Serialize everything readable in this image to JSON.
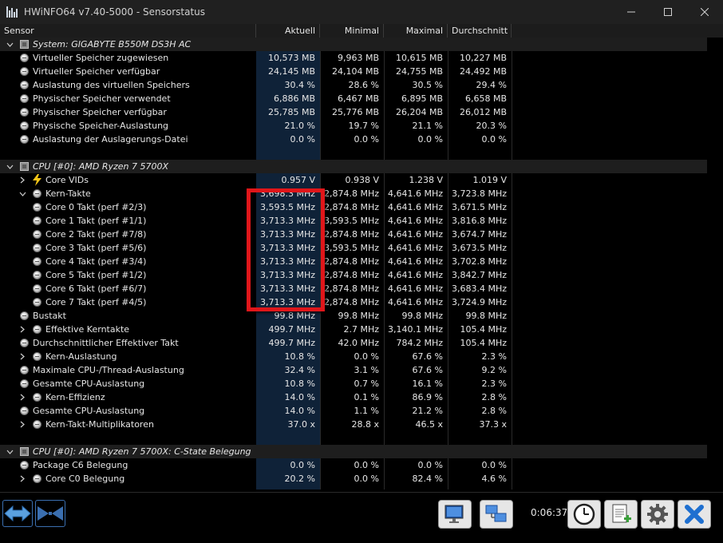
{
  "window": {
    "title": "HWiNFO64 v7.40-5000 - Sensorstatus"
  },
  "columns": {
    "sensor": "Sensor",
    "current": "Aktuell",
    "min": "Minimal",
    "max": "Maximal",
    "avg": "Durchschnitt"
  },
  "rows": [
    {
      "type": "group",
      "label": "System: GIGABYTE B550M DS3H AC"
    },
    {
      "type": "item",
      "label": "Virtueller Speicher zugewiesen",
      "cur": "10,573 MB",
      "min": "9,963 MB",
      "max": "10,615 MB",
      "avg": "10,227 MB"
    },
    {
      "type": "item",
      "label": "Virtueller Speicher verfügbar",
      "cur": "24,145 MB",
      "min": "24,104 MB",
      "max": "24,755 MB",
      "avg": "24,492 MB"
    },
    {
      "type": "item",
      "label": "Auslastung des virtuellen Speichers",
      "cur": "30.4 %",
      "min": "28.6 %",
      "max": "30.5 %",
      "avg": "29.4 %"
    },
    {
      "type": "item",
      "label": "Physischer Speicher verwendet",
      "cur": "6,886 MB",
      "min": "6,467 MB",
      "max": "6,895 MB",
      "avg": "6,658 MB"
    },
    {
      "type": "item",
      "label": "Physischer Speicher verfügbar",
      "cur": "25,785 MB",
      "min": "25,776 MB",
      "max": "26,204 MB",
      "avg": "26,012 MB"
    },
    {
      "type": "item",
      "label": "Physische Speicher-Auslastung",
      "cur": "21.0 %",
      "min": "19.7 %",
      "max": "21.1 %",
      "avg": "20.3 %"
    },
    {
      "type": "item",
      "label": "Auslastung der Auslagerungs-Datei",
      "cur": "0.0 %",
      "min": "0.0 %",
      "max": "0.0 %",
      "avg": "0.0 %"
    },
    {
      "type": "blank"
    },
    {
      "type": "group",
      "label": "CPU [#0]: AMD Ryzen 7 5700X"
    },
    {
      "type": "item",
      "icon": "bolt",
      "label": "Core VIDs",
      "cur": "0.957 V",
      "min": "0.938 V",
      "max": "1.238 V",
      "avg": "1.019 V",
      "expand": true,
      "indent": 1
    },
    {
      "type": "item",
      "label": "Kern-Takte",
      "cur": "3,698.3 MHz",
      "min": "2,874.8 MHz",
      "max": "4,641.6 MHz",
      "avg": "3,723.8 MHz",
      "expand": true,
      "expanded": true,
      "indent": 1
    },
    {
      "type": "item",
      "label": "Core 0 Takt (perf #2/3)",
      "cur": "3,593.5 MHz",
      "min": "2,874.8 MHz",
      "max": "4,641.6 MHz",
      "avg": "3,671.5 MHz",
      "indent": 2
    },
    {
      "type": "item",
      "label": "Core 1 Takt (perf #1/1)",
      "cur": "3,713.3 MHz",
      "min": "3,593.5 MHz",
      "max": "4,641.6 MHz",
      "avg": "3,816.8 MHz",
      "indent": 2
    },
    {
      "type": "item",
      "label": "Core 2 Takt (perf #7/8)",
      "cur": "3,713.3 MHz",
      "min": "2,874.8 MHz",
      "max": "4,641.6 MHz",
      "avg": "3,674.7 MHz",
      "indent": 2
    },
    {
      "type": "item",
      "label": "Core 3 Takt (perf #5/6)",
      "cur": "3,713.3 MHz",
      "min": "3,593.5 MHz",
      "max": "4,641.6 MHz",
      "avg": "3,673.5 MHz",
      "indent": 2
    },
    {
      "type": "item",
      "label": "Core 4 Takt (perf #3/4)",
      "cur": "3,713.3 MHz",
      "min": "2,874.8 MHz",
      "max": "4,641.6 MHz",
      "avg": "3,702.8 MHz",
      "indent": 2
    },
    {
      "type": "item",
      "label": "Core 5 Takt (perf #1/2)",
      "cur": "3,713.3 MHz",
      "min": "2,874.8 MHz",
      "max": "4,641.6 MHz",
      "avg": "3,842.7 MHz",
      "indent": 2
    },
    {
      "type": "item",
      "label": "Core 6 Takt (perf #6/7)",
      "cur": "3,713.3 MHz",
      "min": "2,874.8 MHz",
      "max": "4,641.6 MHz",
      "avg": "3,683.4 MHz",
      "indent": 2
    },
    {
      "type": "item",
      "label": "Core 7 Takt (perf #4/5)",
      "cur": "3,713.3 MHz",
      "min": "2,874.8 MHz",
      "max": "4,641.6 MHz",
      "avg": "3,724.9 MHz",
      "indent": 2
    },
    {
      "type": "item",
      "label": "Bustakt",
      "cur": "99.8 MHz",
      "min": "99.8 MHz",
      "max": "99.8 MHz",
      "avg": "99.8 MHz"
    },
    {
      "type": "item",
      "label": "Effektive Kerntakte",
      "cur": "499.7 MHz",
      "min": "2.7 MHz",
      "max": "3,140.1 MHz",
      "avg": "105.4 MHz",
      "expand": true,
      "indent": 1
    },
    {
      "type": "item",
      "label": "Durchschnittlicher Effektiver Takt",
      "cur": "499.7 MHz",
      "min": "42.0 MHz",
      "max": "784.2 MHz",
      "avg": "105.4 MHz"
    },
    {
      "type": "item",
      "label": "Kern-Auslastung",
      "cur": "10.8 %",
      "min": "0.0 %",
      "max": "67.6 %",
      "avg": "2.3 %",
      "expand": true,
      "indent": 1
    },
    {
      "type": "item",
      "label": "Maximale CPU-/Thread-Auslastung",
      "cur": "32.4 %",
      "min": "3.1 %",
      "max": "67.6 %",
      "avg": "9.2 %"
    },
    {
      "type": "item",
      "label": "Gesamte CPU-Auslastung",
      "cur": "10.8 %",
      "min": "0.7 %",
      "max": "16.1 %",
      "avg": "2.3 %"
    },
    {
      "type": "item",
      "label": "Kern-Effizienz",
      "cur": "14.0 %",
      "min": "0.1 %",
      "max": "86.9 %",
      "avg": "2.8 %",
      "expand": true,
      "indent": 1
    },
    {
      "type": "item",
      "label": "Gesamte CPU-Auslastung",
      "cur": "14.0 %",
      "min": "1.1 %",
      "max": "21.2 %",
      "avg": "2.8 %"
    },
    {
      "type": "item",
      "label": "Kern-Takt-Multiplikatoren",
      "cur": "37.0 x",
      "min": "28.8 x",
      "max": "46.5 x",
      "avg": "37.3 x",
      "expand": true,
      "indent": 1
    },
    {
      "type": "blank"
    },
    {
      "type": "group",
      "label": "CPU [#0]: AMD Ryzen 7 5700X: C-State Belegung"
    },
    {
      "type": "item",
      "label": "Package C6 Belegung",
      "cur": "0.0 %",
      "min": "0.0 %",
      "max": "0.0 %",
      "avg": "0.0 %"
    },
    {
      "type": "item",
      "label": "Core C0 Belegung",
      "cur": "20.2 %",
      "min": "0.0 %",
      "max": "82.4 %",
      "avg": "4.6 %",
      "expand": true,
      "indent": 1
    }
  ],
  "toolbar": {
    "elapsed": "0:06:37"
  },
  "colors": {
    "current_column_bg": "#0f2238",
    "highlight_border": "#e0161a",
    "background": "#000000"
  }
}
